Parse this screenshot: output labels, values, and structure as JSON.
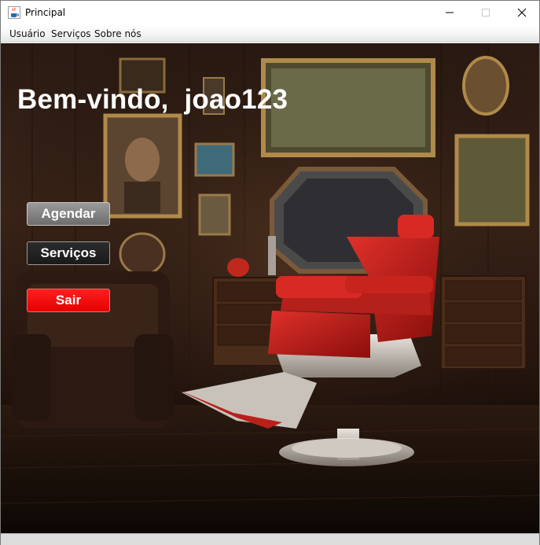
{
  "window": {
    "title": "Principal",
    "controls": {
      "minimize": "—",
      "maximize": "☐",
      "close": "✕"
    }
  },
  "menu": {
    "items": [
      "Usuário",
      "Serviços",
      "Sobre nós"
    ]
  },
  "main": {
    "welcome_prefix": "Bem-vindo,",
    "username": "joao123",
    "buttons": {
      "agendar": "Agendar",
      "servicos": "Serviços",
      "sair": "Sair"
    }
  },
  "icons": {
    "app": "java-coffee-icon",
    "background": "barbershop-interior-image"
  },
  "colors": {
    "sair_button": "#ff0000",
    "agendar_button": "#7f7f7f",
    "servicos_button": "#202020",
    "welcome_text": "#ffffff"
  }
}
